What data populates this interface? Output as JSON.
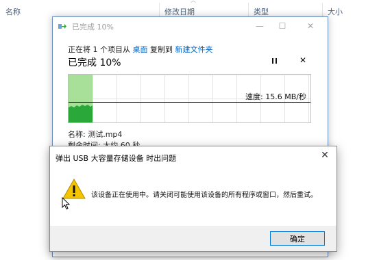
{
  "explorer": {
    "columns": {
      "name": "名称",
      "modified": "修改日期",
      "type": "类型",
      "size": "大小"
    }
  },
  "copy_dialog": {
    "title": "已完成 10%",
    "progress_fraction": 0.1,
    "copy_text": {
      "prefix": "正在将 1 个项目从 ",
      "source": "桌面",
      "middle": " 复制到 ",
      "destination": "新建文件夹"
    },
    "percent_heading": "已完成 10%",
    "speed": "速度: 15.6 MB/秒",
    "file_name": "名称: 测试.mp4",
    "time_remaining": "剩余时间: 大约 60 秒",
    "icons": {
      "pause": "pause-icon",
      "cancel": "close-icon"
    },
    "colors": {
      "graph_fill": "#9fdc8e",
      "graph_bars": "#2aa83a",
      "link": "#0066cc"
    }
  },
  "error_dialog": {
    "title": "弹出 USB 大容量存储设备 时出问题",
    "message": "该设备正在使用中。请关闭可能使用该设备的所有程序或窗口，然后重试。",
    "ok_label": "确定",
    "icon": "warning-icon",
    "colors": {
      "warning": "#f5c400",
      "button_border": "#0078d7"
    }
  }
}
